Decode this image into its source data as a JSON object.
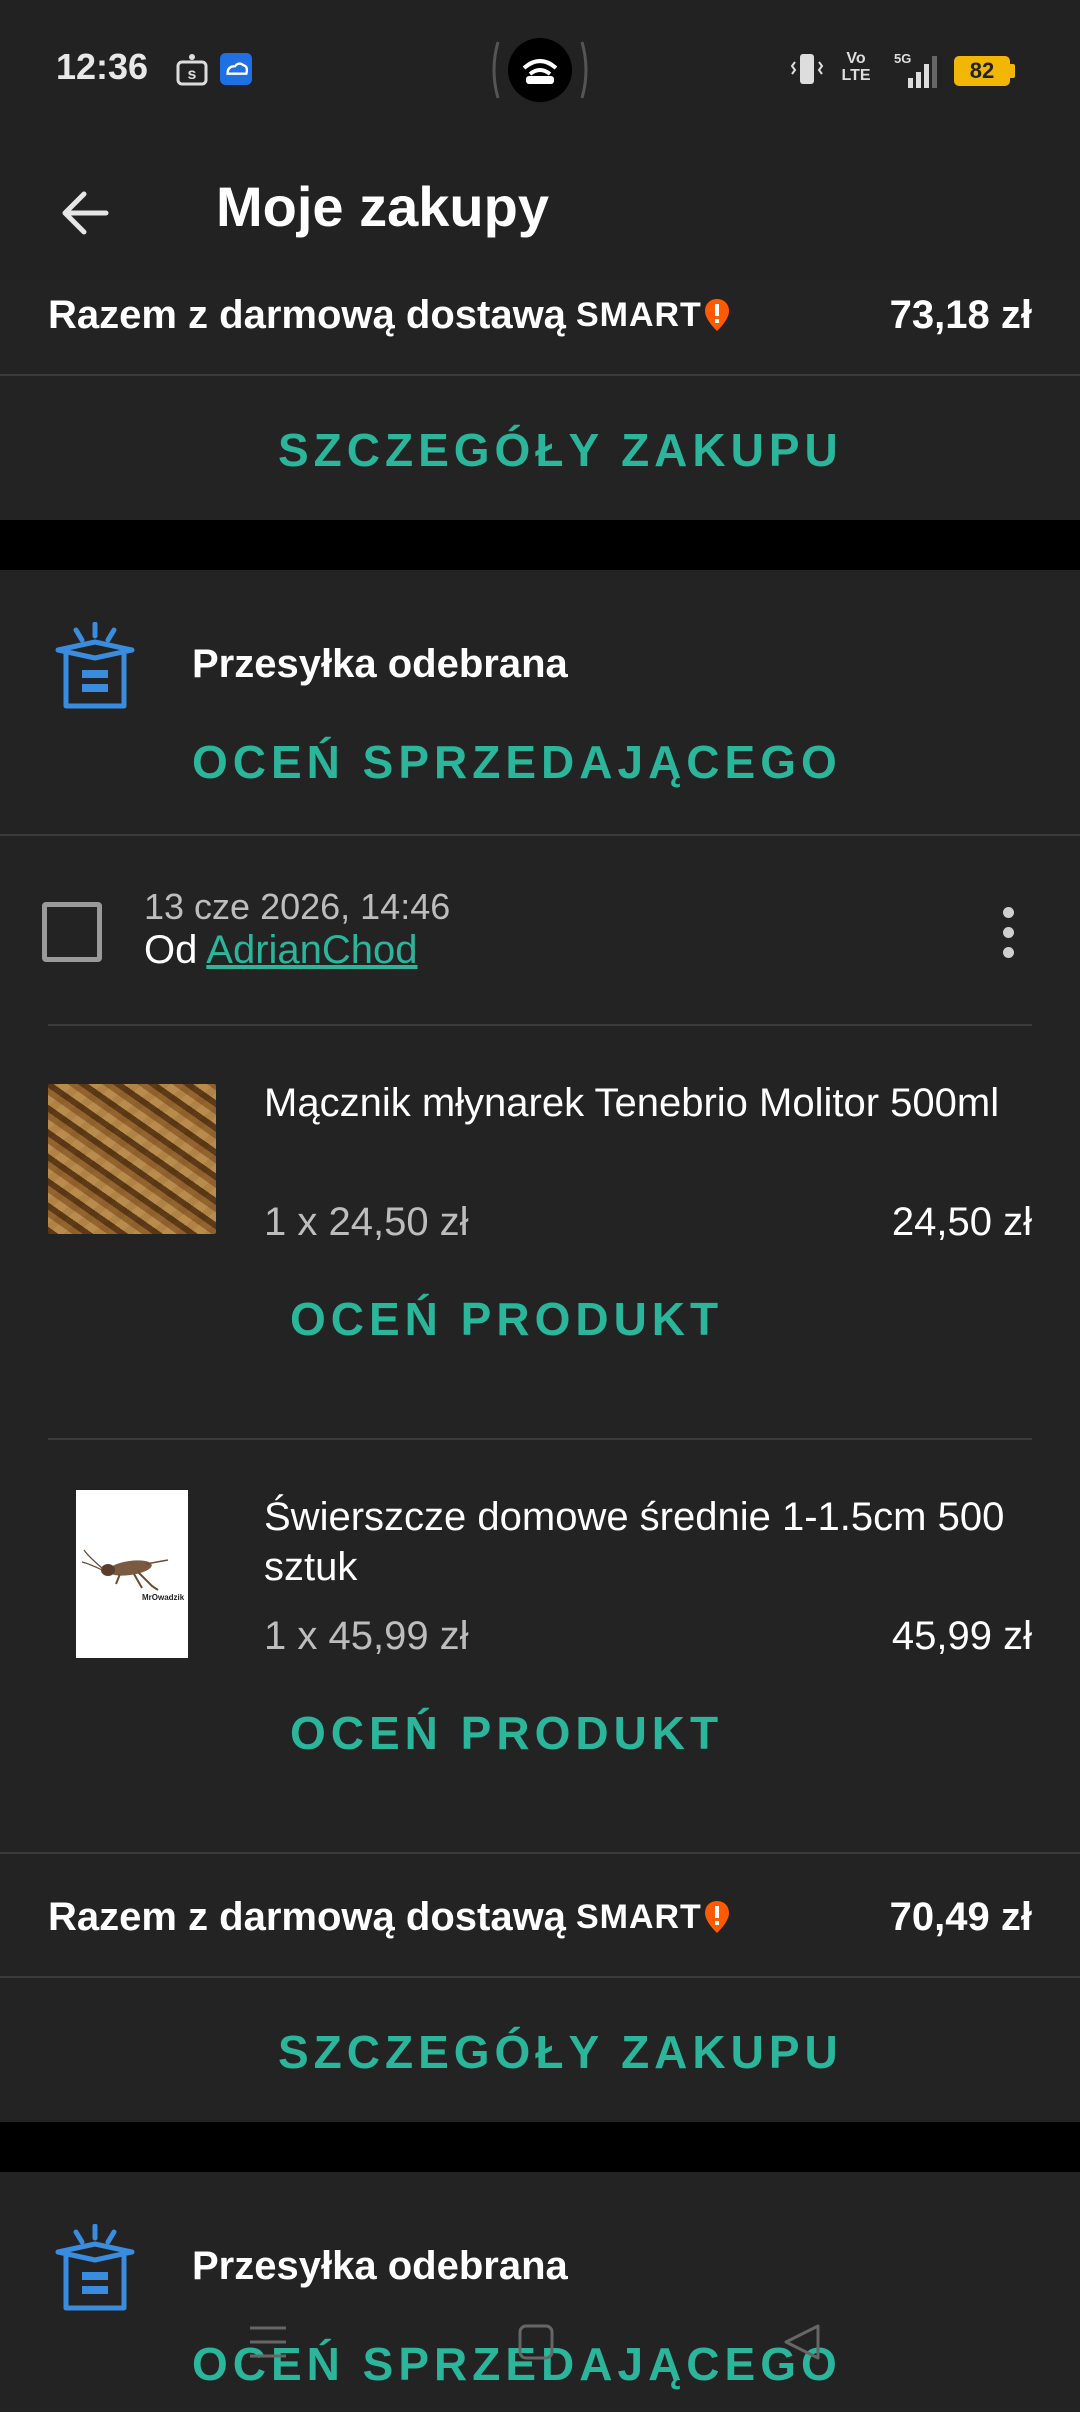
{
  "status_bar": {
    "time": "12:36",
    "battery": "82",
    "icons": [
      "s-app-icon",
      "cloud-app-icon",
      "hotspot-icon",
      "vibrate-icon",
      "volte-icon",
      "5g-signal-icon",
      "battery-icon"
    ],
    "volte_line1": "Vo",
    "volte_line2": "LTE",
    "net_label": "5G"
  },
  "app_bar": {
    "title": "Moje zakupy",
    "back_icon": "arrow-left-icon"
  },
  "order1": {
    "total_label": "Razem z darmową dostawą",
    "smart_label": "SMART",
    "total_value": "73,18 zł",
    "details_button": "SZCZEGÓŁY ZAKUPU"
  },
  "order2": {
    "status": "Przesyłka odebrana",
    "rate_seller_button": "OCEŃ SPRZEDAJĄCEGO",
    "date": "13 cze 2026, 14:46",
    "from_prefix": "Od",
    "seller": "AdrianChod",
    "products": [
      {
        "name": "Mącznik młynarek Tenebrio Molitor 500ml",
        "qty": "1 x 24,50 zł",
        "price": "24,50 zł",
        "rate_button": "OCEŃ PRODUKT"
      },
      {
        "name": "Świerszcze domowe średnie 1-1.5cm 500 sztuk",
        "qty": "1 x 45,99 zł",
        "price": "45,99 zł",
        "rate_button": "OCEŃ PRODUKT",
        "image_caption": "MrOwadzik"
      }
    ],
    "total_label": "Razem z darmową dostawą",
    "smart_label": "SMART",
    "total_value": "70,49 zł",
    "details_button": "SZCZEGÓŁY ZAKUPU"
  },
  "order3": {
    "status": "Przesyłka odebrana",
    "rate_seller_button": "OCEŃ SPRZEDAJĄCEGO"
  },
  "colors": {
    "accent": "#2bb59b",
    "background": "#000000",
    "card": "#232323",
    "smart_badge": "#ff5a00",
    "icon_blue": "#3a8dde"
  }
}
